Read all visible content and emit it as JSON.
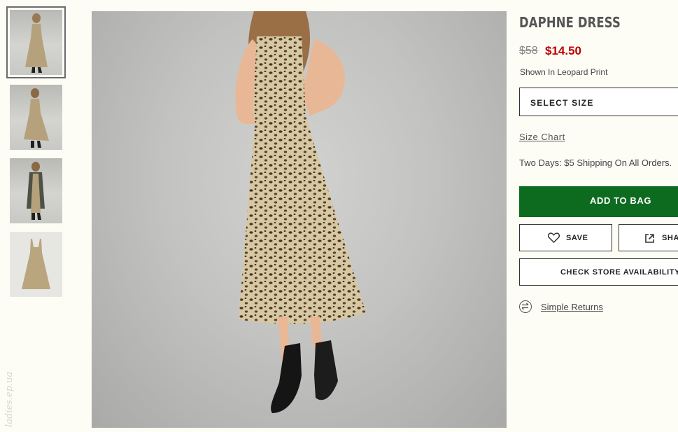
{
  "product": {
    "title": "DAPHNE DRESS",
    "price_original": "$58",
    "price_sale": "$14.50",
    "shown_in": "Shown In Leopard Print",
    "size_select": "SELECT SIZE",
    "size_chart": "Size Chart",
    "shipping": "Two Days: $5 Shipping On All Orders.",
    "add_to_bag": "ADD TO BAG",
    "save": "SAVE",
    "share": "SHARE",
    "check_store": "CHECK STORE AVAILABILITY",
    "returns": "Simple Returns"
  },
  "gallery": {
    "thumbnails": [
      "thumbnail-front",
      "thumbnail-back",
      "thumbnail-cardigan",
      "thumbnail-flat"
    ],
    "selected_index": 0
  },
  "watermark": "ladies.ep.ua",
  "colors": {
    "accent_green": "#0d6b1f",
    "sale_red": "#c00000",
    "background": "#fdfdf6"
  }
}
